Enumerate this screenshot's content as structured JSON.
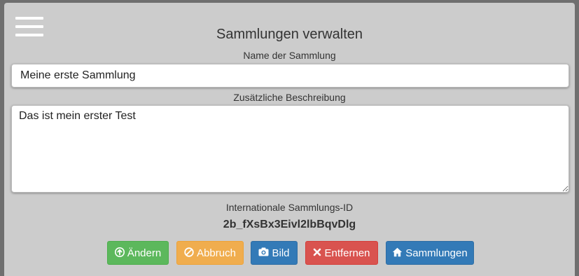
{
  "header": {
    "title": "Sammlungen verwalten"
  },
  "form": {
    "name_label": "Name der Sammlung",
    "name_value": "Meine erste Sammlung",
    "desc_label": "Zusätzliche Beschreibung",
    "desc_value": "Das ist mein erster Test",
    "id_label": "Internationale Sammlungs-ID",
    "id_value": "2b_fXsBx3Eivl2lbBqvDlg"
  },
  "buttons": {
    "change": "Ändern",
    "cancel": "Abbruch",
    "image": "Bild",
    "remove": "Entfernen",
    "collections": "Sammlungen"
  },
  "colors": {
    "success": "#5cb85c",
    "warning": "#f0ad4e",
    "primary": "#337ab7",
    "danger": "#d9534f"
  },
  "icons": {
    "menu": "hamburger-menu-icon",
    "change": "arrow-up-circle-icon",
    "cancel": "ban-icon",
    "image": "camera-icon",
    "remove": "x-icon",
    "collections": "home-icon"
  }
}
